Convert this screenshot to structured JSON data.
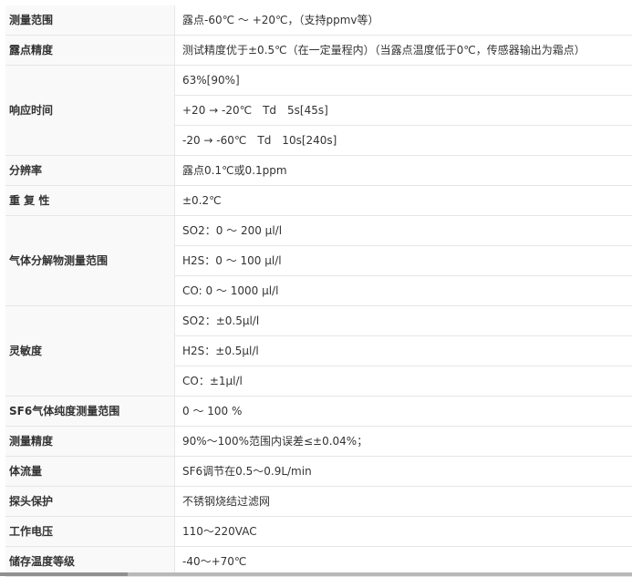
{
  "spec_table": {
    "rows": [
      {
        "label": "测量范围",
        "values": [
          "露点-60℃ ～ +20℃，（支持ppmv等）"
        ]
      },
      {
        "label": "露点精度",
        "values": [
          "测试精度优于±0.5℃（在一定量程内）（当露点温度低于0℃，传感器输出为霜点）"
        ]
      },
      {
        "label": "响应时间",
        "values": [
          "63%[90%]",
          "+20 → -20℃　Td　5s[45s]",
          "-20 → -60℃　Td　10s[240s]"
        ]
      },
      {
        "label": "分辨率",
        "values": [
          "露点0.1℃或0.1ppm"
        ]
      },
      {
        "label": "重 复 性",
        "values": [
          "±0.2℃"
        ]
      },
      {
        "label": "气体分解物测量范围",
        "values": [
          "SO2：0 ～ 200 μl/l",
          "H2S：0 ～ 100 μl/l",
          "CO: 0 ～ 1000 μl/l"
        ]
      },
      {
        "label": "灵敏度",
        "values": [
          "SO2：±0.5μl/l",
          "H2S：±0.5μl/l",
          "CO：±1μl/l"
        ]
      },
      {
        "label": "SF6气体纯度测量范围",
        "values": [
          "0 ～ 100 %"
        ]
      },
      {
        "label": "测量精度",
        "values": [
          "90%～100%范围内误差≤±0.04%；"
        ]
      },
      {
        "label": "体流量",
        "values": [
          "SF6调节在0.5～0.9L/min"
        ]
      },
      {
        "label": "探头保护",
        "values": [
          "不锈钢烧结过滤网"
        ]
      },
      {
        "label": "工作电压",
        "values": [
          "110～220VAC"
        ]
      },
      {
        "label": "储存温度等级",
        "values": [
          "-40～+70℃"
        ]
      }
    ]
  }
}
